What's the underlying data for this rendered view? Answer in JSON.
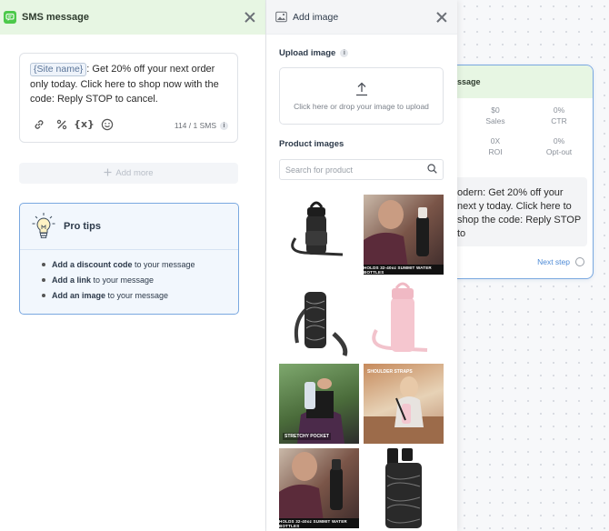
{
  "sms_panel": {
    "title": "SMS message",
    "message": {
      "token": "{Site name}",
      "text": ": Get 20% off your next order only today. Click here to shop now with the code: Reply STOP to cancel."
    },
    "tools": {
      "variable_label": "{x}"
    },
    "sms_count": "114 / 1 SMS",
    "add_more_label": "Add more",
    "pro_tips": {
      "title": "Pro tips",
      "items": [
        {
          "bold": "Add a discount code",
          "rest": " to your message"
        },
        {
          "bold": "Add a link",
          "rest": " to your message"
        },
        {
          "bold": "Add an image",
          "rest": " to your message"
        }
      ]
    }
  },
  "image_panel": {
    "title": "Add image",
    "upload_label": "Upload image",
    "upload_hint": "Click here or drop your image to upload",
    "products_label": "Product images",
    "search_placeholder": "Search for product",
    "thumb_texts": {
      "t2_banner": "HOLDS 32-40oz SUMMIT WATER BOTTLES",
      "t5_overlay": "STRETCHY POCKET",
      "t6_top": "SHOULDER STRAPS",
      "t7_banner": "HOLDS 32-40oz SUMMIT WATER BOTTLES"
    }
  },
  "flow_node": {
    "head_label": "ssage",
    "stats": [
      {
        "value": "$0",
        "label": "Sales"
      },
      {
        "value": "0%",
        "label": "CTR"
      },
      {
        "value": "0X",
        "label": "ROI"
      },
      {
        "value": "0%",
        "label": "Opt-out"
      }
    ],
    "message_preview": "odern: Get 20% off your next y today. Click here to shop the code: Reply STOP to",
    "next_step_label": "Next step"
  },
  "colors": {
    "sms_header_bg": "#e7f6e3",
    "sms_icon": "#4cc94a",
    "accent_blue": "#7aa8e0",
    "link_blue": "#4d8ad6"
  }
}
